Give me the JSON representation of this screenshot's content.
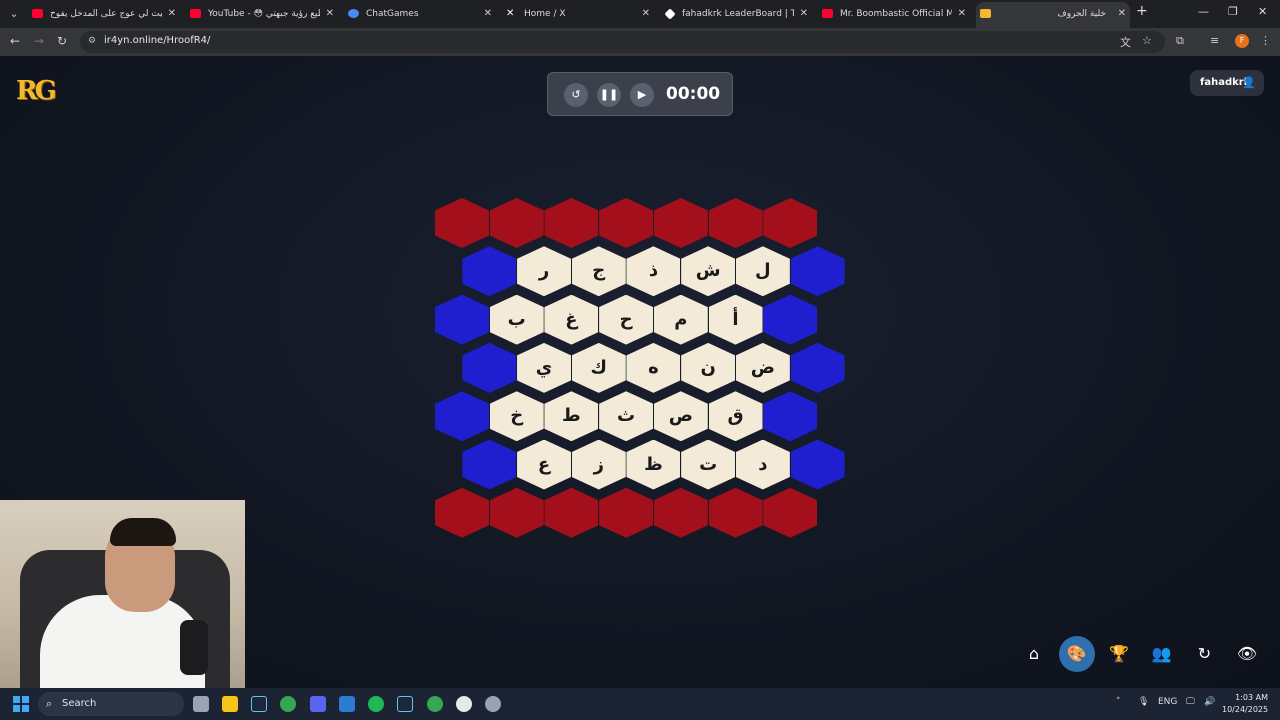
{
  "browser": {
    "tabs": [
      {
        "label": "حطيت لي عوج على المدخل يفوح",
        "favicon_color": "#ff0033"
      },
      {
        "label": "YouTube - 😳 لا استطيع رؤية جبهتي",
        "favicon_color": "#ff0033"
      },
      {
        "label": "ChatGames",
        "favicon_color": "#4a8af4"
      },
      {
        "label": "Home / X",
        "favicon_color": "#ffffff"
      },
      {
        "label": "fahadkrk LeaderBoard | The best",
        "favicon_color": "#ffffff"
      },
      {
        "label": "Mr. Boombastic Official Music Video",
        "favicon_color": "#ff0033"
      },
      {
        "label": "خلية الحروف",
        "favicon_color": "#f2b830"
      }
    ],
    "url": "ir4yn.online/HroofR4/",
    "profile_initial": "F"
  },
  "app": {
    "logo": "RG",
    "timer": "00:00",
    "username": "fahadkrk"
  },
  "board": {
    "colors": {
      "red": "#a3101c",
      "blue": "#1f1fd0",
      "cell": "#f3ead8"
    },
    "rows": [
      [
        "red",
        "red",
        "red",
        "red",
        "red",
        "red",
        "red"
      ],
      [
        "blue",
        "ر",
        "ج",
        "ذ",
        "ش",
        "ل",
        "blue"
      ],
      [
        "blue",
        "ب",
        "غ",
        "ح",
        "م",
        "أ",
        "blue"
      ],
      [
        "blue",
        "ي",
        "ك",
        "ه",
        "ن",
        "ض",
        "blue"
      ],
      [
        "blue",
        "خ",
        "ط",
        "ث",
        "ص",
        "ق",
        "blue"
      ],
      [
        "blue",
        "ع",
        "ز",
        "ظ",
        "ت",
        "د",
        "blue"
      ],
      [
        "red",
        "red",
        "red",
        "red",
        "red",
        "red",
        "red"
      ]
    ]
  },
  "actions": [
    {
      "name": "home-button",
      "icon": "home-icon",
      "glyph": "⌂"
    },
    {
      "name": "theme-button",
      "icon": "palette-icon",
      "glyph": "🎨"
    },
    {
      "name": "leaderboard-button",
      "icon": "trophy-icon",
      "glyph": "🏆"
    },
    {
      "name": "teams-button",
      "icon": "users-icon",
      "glyph": "👥"
    },
    {
      "name": "refresh-button",
      "icon": "refresh-icon",
      "glyph": "↻"
    },
    {
      "name": "view-button",
      "icon": "eye-icon",
      "glyph": "👁"
    }
  ],
  "taskbar": {
    "search_placeholder": "Search",
    "language": "ENG",
    "time": "1:03 AM",
    "date": "10/24/2025"
  }
}
